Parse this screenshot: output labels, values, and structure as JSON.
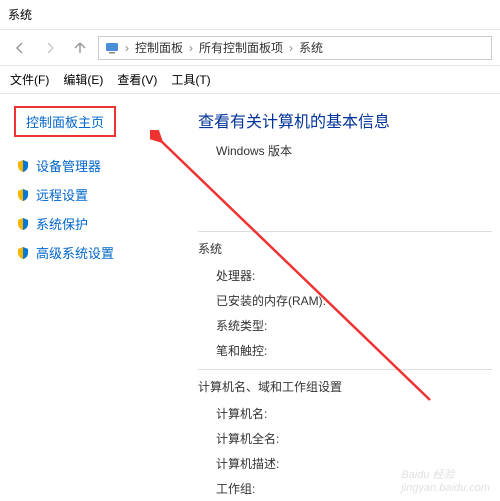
{
  "window": {
    "title": "系统"
  },
  "breadcrumb": {
    "items": [
      "控制面板",
      "所有控制面板项",
      "系统"
    ]
  },
  "menubar": {
    "items": [
      "文件(F)",
      "编辑(E)",
      "查看(V)",
      "工具(T)"
    ]
  },
  "sidebar": {
    "home": "控制面板主页",
    "links": [
      "设备管理器",
      "远程设置",
      "系统保护",
      "高级系统设置"
    ]
  },
  "main": {
    "heading": "查看有关计算机的基本信息",
    "winver_title": "Windows 版本",
    "system_title": "系统",
    "rows": {
      "cpu": "处理器:",
      "ram": "已安装的内存(RAM):",
      "systype": "系统类型:",
      "pentouch": "笔和触控:"
    },
    "netid_title": "计算机名、域和工作组设置",
    "netrows": {
      "name": "计算机名:",
      "fullname": "计算机全名:",
      "desc": "计算机描述:",
      "workgroup": "工作组:"
    }
  },
  "watermark": {
    "brand": "Baidu",
    "sub": "经验",
    "site": "jingyan.baidu.com"
  }
}
